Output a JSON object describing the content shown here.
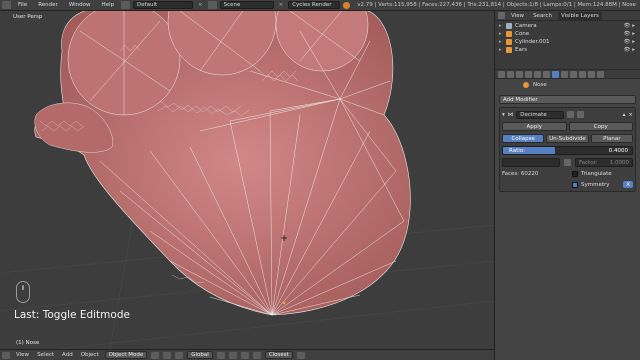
{
  "topbar": {
    "menus": [
      "File",
      "Render",
      "Window",
      "Help"
    ],
    "layout": "Default",
    "scene": "Scene",
    "engine": "Cycles Render",
    "stats": "v2.79 | Verts:115,958 | Faces:227,436 | Tris:231,814 | Objects:1/8 | Lamps:0/1 | Mem:124.88M | Nose"
  },
  "viewport": {
    "view_label": "User Persp",
    "last_operation": "Last: Toggle Editmode",
    "object_label": "(1) Nose"
  },
  "bottombar": {
    "menus": [
      "View",
      "Select",
      "Add",
      "Object"
    ],
    "mode": "Object Mode",
    "pivot": "Global",
    "snap": "Closest"
  },
  "outliner": {
    "tabs": [
      "View",
      "Search"
    ],
    "filter": "Visible Layers",
    "items": [
      {
        "name": "Camera",
        "color": "#9fb0c6"
      },
      {
        "name": "Cone",
        "color": "#e8963c"
      },
      {
        "name": "Cylinder.001",
        "color": "#e8963c"
      },
      {
        "name": "Ears",
        "color": "#e8963c"
      }
    ]
  },
  "properties": {
    "object_name": "Nose",
    "add_modifier": "Add Modifier",
    "modifier": {
      "name": "Decimate",
      "apply": "Apply",
      "copy": "Copy",
      "modes": [
        "Collapse",
        "Un-Subdivide",
        "Planar"
      ],
      "active_mode": "Collapse",
      "ratio_label": "Ratio:",
      "ratio_value": "0.4000",
      "ratio": 0.4,
      "vertex_group_placeholder": "",
      "factor_label": "Factor:",
      "factor_value": "1.0000",
      "faces": "Faces: 60220",
      "triangulate": "Triangulate",
      "triangulate_on": false,
      "symmetry": "Symmetry",
      "symmetry_on": true,
      "symmetry_axis": "X"
    }
  },
  "colors": {
    "mesh": "#c47a78",
    "wire": "#ffffff",
    "accent": "#5680c2"
  }
}
